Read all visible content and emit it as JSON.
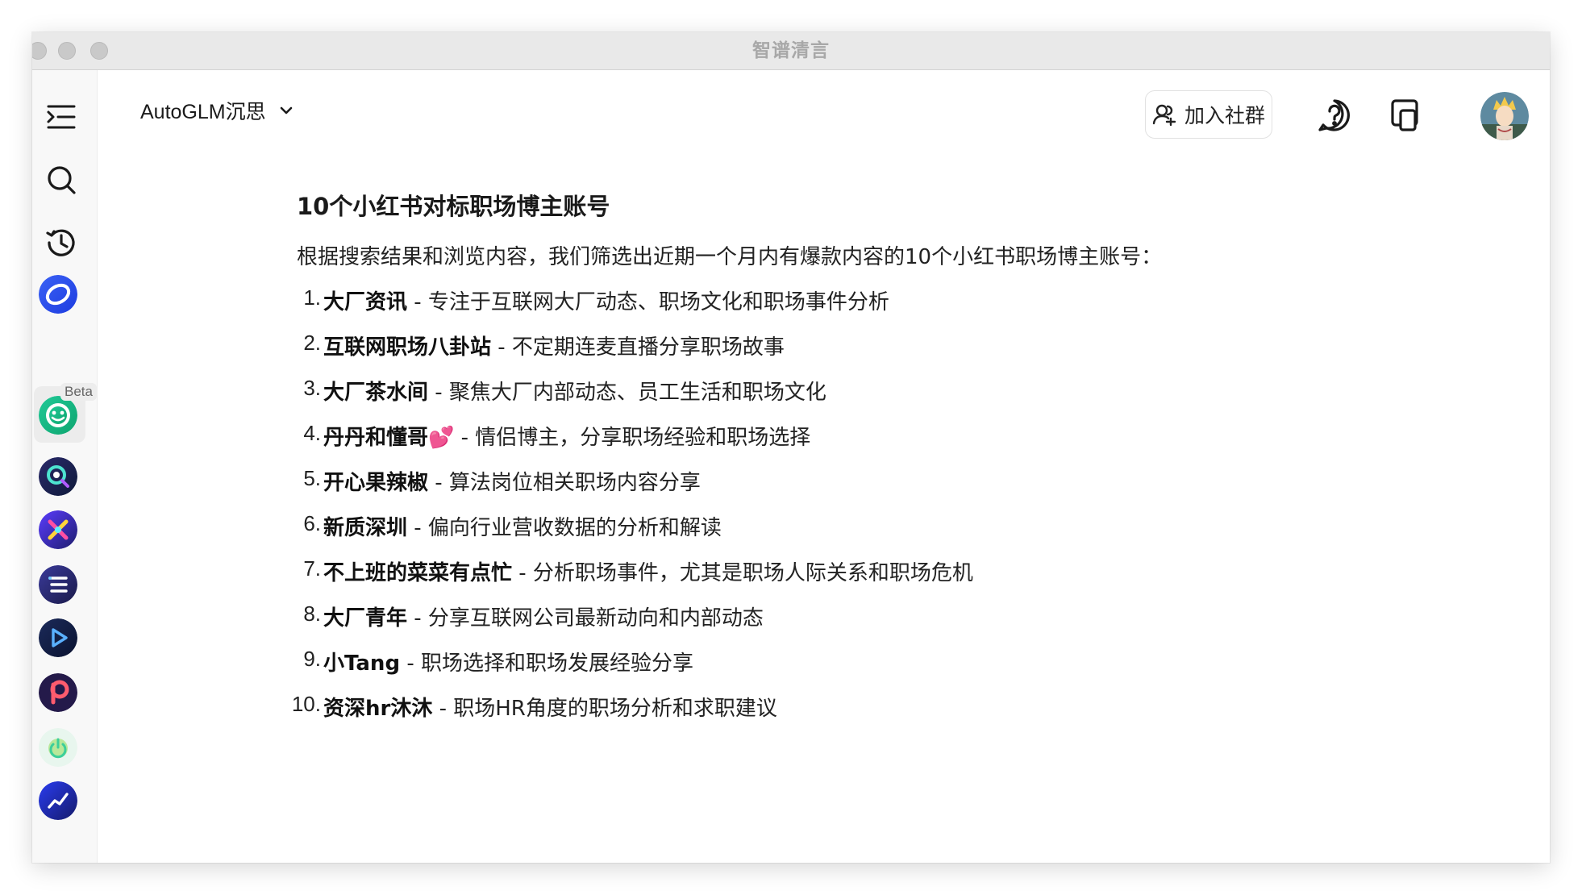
{
  "window": {
    "title": "智谱清言"
  },
  "header": {
    "model_name": "AutoGLM沉思",
    "join_label": "加入社群"
  },
  "sidebar": {
    "beta_label": "Beta",
    "icons": [
      "menu-icon",
      "search-icon",
      "history-icon"
    ]
  },
  "content": {
    "heading": "10个小红书对标职场博主账号",
    "intro": "根据搜索结果和浏览内容，我们筛选出近期一个月内有爆款内容的10个小红书职场博主账号：",
    "items": [
      {
        "num": "1.",
        "name": "大厂资讯",
        "desc": " - 专注于互联网大厂动态、职场文化和职场事件分析"
      },
      {
        "num": "2.",
        "name": "互联网职场八卦站",
        "desc": " - 不定期连麦直播分享职场故事"
      },
      {
        "num": "3.",
        "name": "大厂茶水间",
        "desc": " - 聚焦大厂内部动态、员工生活和职场文化"
      },
      {
        "num": "4.",
        "name": "丹丹和懂哥💕",
        "desc": " - 情侣博主，分享职场经验和职场选择"
      },
      {
        "num": "5.",
        "name": "开心果辣椒",
        "desc": " - 算法岗位相关职场内容分享"
      },
      {
        "num": "6.",
        "name": "新质深圳",
        "desc": " - 偏向行业营收数据的分析和解读"
      },
      {
        "num": "7.",
        "name": "不上班的菜菜有点忙",
        "desc": " - 分析职场事件，尤其是职场人际关系和职场危机"
      },
      {
        "num": "8.",
        "name": "大厂青年",
        "desc": " - 分享互联网公司最新动向和内部动态"
      },
      {
        "num": "9.",
        "name": "小Tang",
        "desc": " - 职场选择和职场发展经验分享"
      },
      {
        "num": "10.",
        "name": "资深hr沐沐",
        "desc": " - 职场HR角度的职场分析和求职建议"
      }
    ]
  }
}
